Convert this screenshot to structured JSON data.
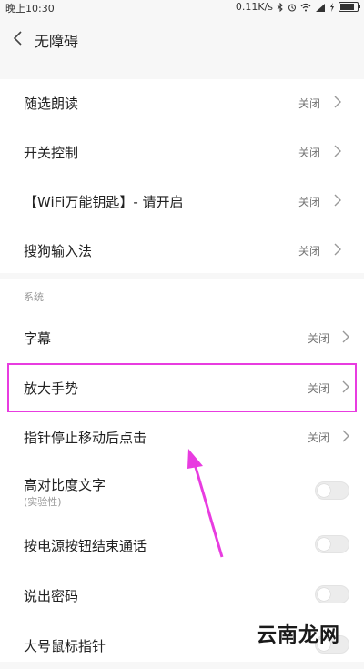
{
  "status_bar": {
    "time": "晚上10:30",
    "network_speed": "0.11K/s",
    "icons": [
      "bluetooth-icon",
      "alarm-icon",
      "wifi-icon",
      "signal-icon",
      "charging-icon",
      "battery-icon"
    ]
  },
  "header": {
    "back_icon": "chevron-left-icon",
    "title": "无障碍"
  },
  "services": [
    {
      "label": "随选朗读",
      "value": "关闭"
    },
    {
      "label": "开关控制",
      "value": "关闭"
    },
    {
      "label": "【WiFi万能钥匙】- 请开启",
      "value": "关闭"
    },
    {
      "label": "搜狗输入法",
      "value": "关闭"
    }
  ],
  "system": {
    "section_title": "系统",
    "items": [
      {
        "label": "字幕",
        "value": "关闭"
      },
      {
        "label": "放大手势",
        "value": "关闭"
      },
      {
        "label": "指针停止移动后点击",
        "value": "关闭"
      }
    ],
    "toggles": [
      {
        "label": "高对比度文字",
        "sublabel": "(实验性)",
        "on": false
      },
      {
        "label": "按电源按钮结束通话",
        "on": false
      },
      {
        "label": "说出密码",
        "on": false
      },
      {
        "label": "大号鼠标指针",
        "on": false
      }
    ]
  },
  "annotation": {
    "highlight_color": "#e83ce0",
    "arrow_color": "#e83ce0"
  },
  "watermark": "云南龙网",
  "colors": {
    "background": "#f7f7f7",
    "card": "#ffffff",
    "value_text": "#777777"
  },
  "battery_level": 0.85
}
